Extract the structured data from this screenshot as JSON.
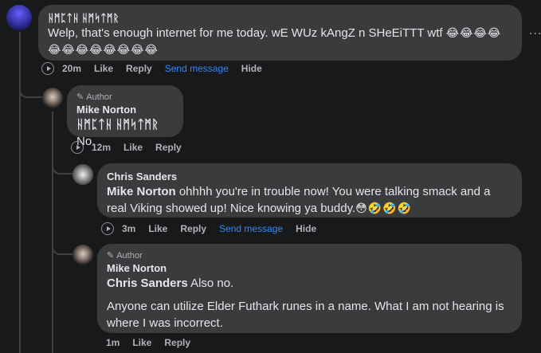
{
  "comments": [
    {
      "name": "ᚺᛗᛈᛏᚺ ᚺᛗᛋᛏᛗᚱ",
      "text": "Welp, that's enough internet for me today. wE WUz kAngZ n SHeEiTTT wtf",
      "emoji": "😂😂😂😂😂😂😂😂😂😂😂😂",
      "time": "20m",
      "like": "Like",
      "reply": "Reply",
      "send": "Send message",
      "hide": "Hide"
    },
    {
      "badge": "Author",
      "name": "Mike Norton",
      "mention": "ᚺᛗᛈᛏᚺ ᚺᛗᛋᛏᛗᚱ",
      "text": "No.",
      "time": "12m",
      "like": "Like",
      "reply": "Reply"
    },
    {
      "name": "Chris Sanders",
      "mention": "Mike Norton",
      "text": "ohhhh you're in trouble now! You were talking smack and a real Viking showed up! Nice knowing ya buddy.",
      "emoji": "😳🤣🤣🤣",
      "time": "3m",
      "like": "Like",
      "reply": "Reply",
      "send": "Send message",
      "hide": "Hide"
    },
    {
      "badge": "Author",
      "name": "Mike Norton",
      "mention": "Chris Sanders",
      "text": "Also no.",
      "text2": "Anyone can utilize Elder Futhark runes in a name. What I am not hearing is where I was incorrect.",
      "time": "1m",
      "like": "Like",
      "reply": "Reply"
    }
  ],
  "more_label": "..."
}
